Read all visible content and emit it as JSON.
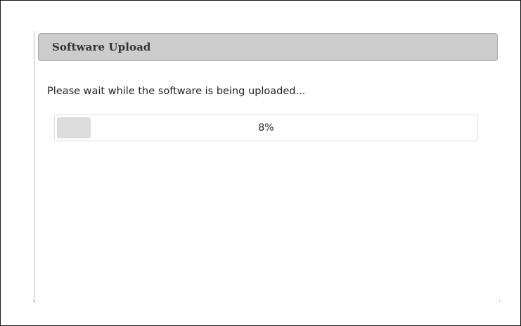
{
  "dialog": {
    "title": "Software Upload",
    "message": "Please wait while the software is being uploaded...",
    "progress": {
      "value_percent": 8,
      "label": "8%"
    }
  },
  "colors": {
    "header_background": "#cccccc",
    "header_border": "#a9a9a9",
    "progress_fill": "#dcdcdc",
    "progress_border": "#dedede",
    "text": "#222222"
  }
}
